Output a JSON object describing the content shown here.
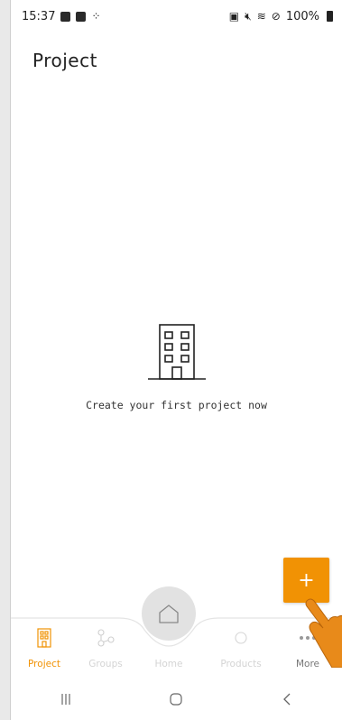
{
  "status_bar": {
    "time": "15:37",
    "battery": "100%"
  },
  "page": {
    "title": "Project"
  },
  "empty_state": {
    "icon": "building-icon",
    "message": "Create your first project now"
  },
  "fab": {
    "label": "+",
    "icon": "plus-icon"
  },
  "bottom_nav": {
    "items": [
      {
        "label": "Project",
        "icon": "building-icon",
        "active": true
      },
      {
        "label": "Groups",
        "icon": "groups-icon",
        "active": false
      },
      {
        "label": "Home",
        "icon": "home-icon",
        "active": false
      },
      {
        "label": "Products",
        "icon": "products-icon",
        "active": false
      },
      {
        "label": "More",
        "icon": "more-icon",
        "active": false
      }
    ]
  },
  "colors": {
    "accent": "#f19204",
    "inactive": "#d4d4d4",
    "home_button_bg": "#e2e2e2"
  }
}
